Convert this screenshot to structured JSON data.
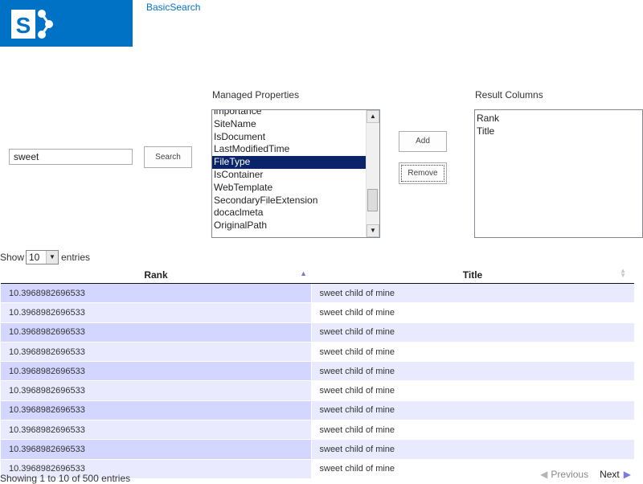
{
  "header": {
    "site_link": "BasicSearch"
  },
  "search": {
    "value": "sweet",
    "button_label": "Search"
  },
  "managed_properties": {
    "label": "Managed Properties",
    "items": [
      "importance",
      "SiteName",
      "IsDocument",
      "LastModifiedTime",
      "FileType",
      "IsContainer",
      "WebTemplate",
      "SecondaryFileExtension",
      "docaclmeta",
      "OriginalPath"
    ],
    "selected": "FileType"
  },
  "actions": {
    "add_label": "Add",
    "remove_label": "Remove"
  },
  "result_columns": {
    "label": "Result Columns",
    "items": [
      "Rank",
      "Title"
    ]
  },
  "length": {
    "show_label": "Show",
    "value": "10",
    "entries_label": "entries"
  },
  "table": {
    "columns": [
      "Rank",
      "Title"
    ],
    "rows": [
      [
        "10.3968982696533",
        "sweet child of mine"
      ],
      [
        "10.3968982696533",
        "sweet child of mine"
      ],
      [
        "10.3968982696533",
        "sweet child of mine"
      ],
      [
        "10.3968982696533",
        "sweet child of mine"
      ],
      [
        "10.3968982696533",
        "sweet child of mine"
      ],
      [
        "10.3968982696533",
        "sweet child of mine"
      ],
      [
        "10.3968982696533",
        "sweet child of mine"
      ],
      [
        "10.3968982696533",
        "sweet child of mine"
      ],
      [
        "10.3968982696533",
        "sweet child of mine"
      ],
      [
        "10.3968982696533",
        "sweet child of mine"
      ]
    ]
  },
  "footer": {
    "info": "Showing 1 to 10 of 500 entries",
    "previous_label": "Previous",
    "next_label": "Next"
  },
  "colors": {
    "brand": "#0072c6",
    "selected_item": "#0a246a",
    "row_odd_rank": "#d3d6ff",
    "row_alt": "#eaeaff"
  }
}
